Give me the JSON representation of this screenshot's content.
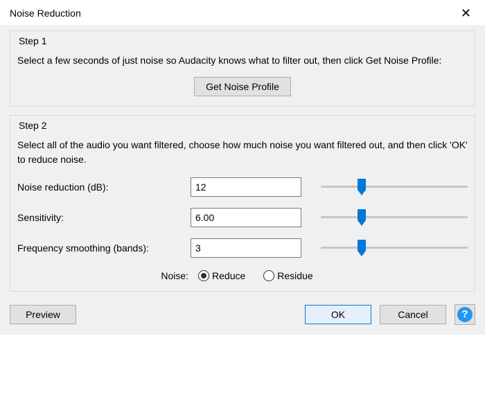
{
  "window": {
    "title": "Noise Reduction",
    "close_symbol": "✕"
  },
  "step1": {
    "legend": "Step 1",
    "text": "Select a few seconds of just noise so Audacity knows what to filter out, then click Get Noise Profile:",
    "button_label": "Get Noise Profile"
  },
  "step2": {
    "legend": "Step 2",
    "text": "Select all of the audio you want filtered, choose how much noise you want filtered out, and then click 'OK' to reduce noise.",
    "params": {
      "noise_reduction": {
        "label": "Noise reduction (dB):",
        "value": "12",
        "slider_percent": 28
      },
      "sensitivity": {
        "label": "Sensitivity:",
        "value": "6.00",
        "slider_percent": 28
      },
      "freq_smoothing": {
        "label": "Frequency smoothing (bands):",
        "value": "3",
        "slider_percent": 28
      }
    },
    "noise_label": "Noise:",
    "radios": {
      "reduce": {
        "label": "Reduce",
        "checked": true
      },
      "residue": {
        "label": "Residue",
        "checked": false
      }
    }
  },
  "footer": {
    "preview": "Preview",
    "ok": "OK",
    "cancel": "Cancel",
    "help_symbol": "?"
  }
}
